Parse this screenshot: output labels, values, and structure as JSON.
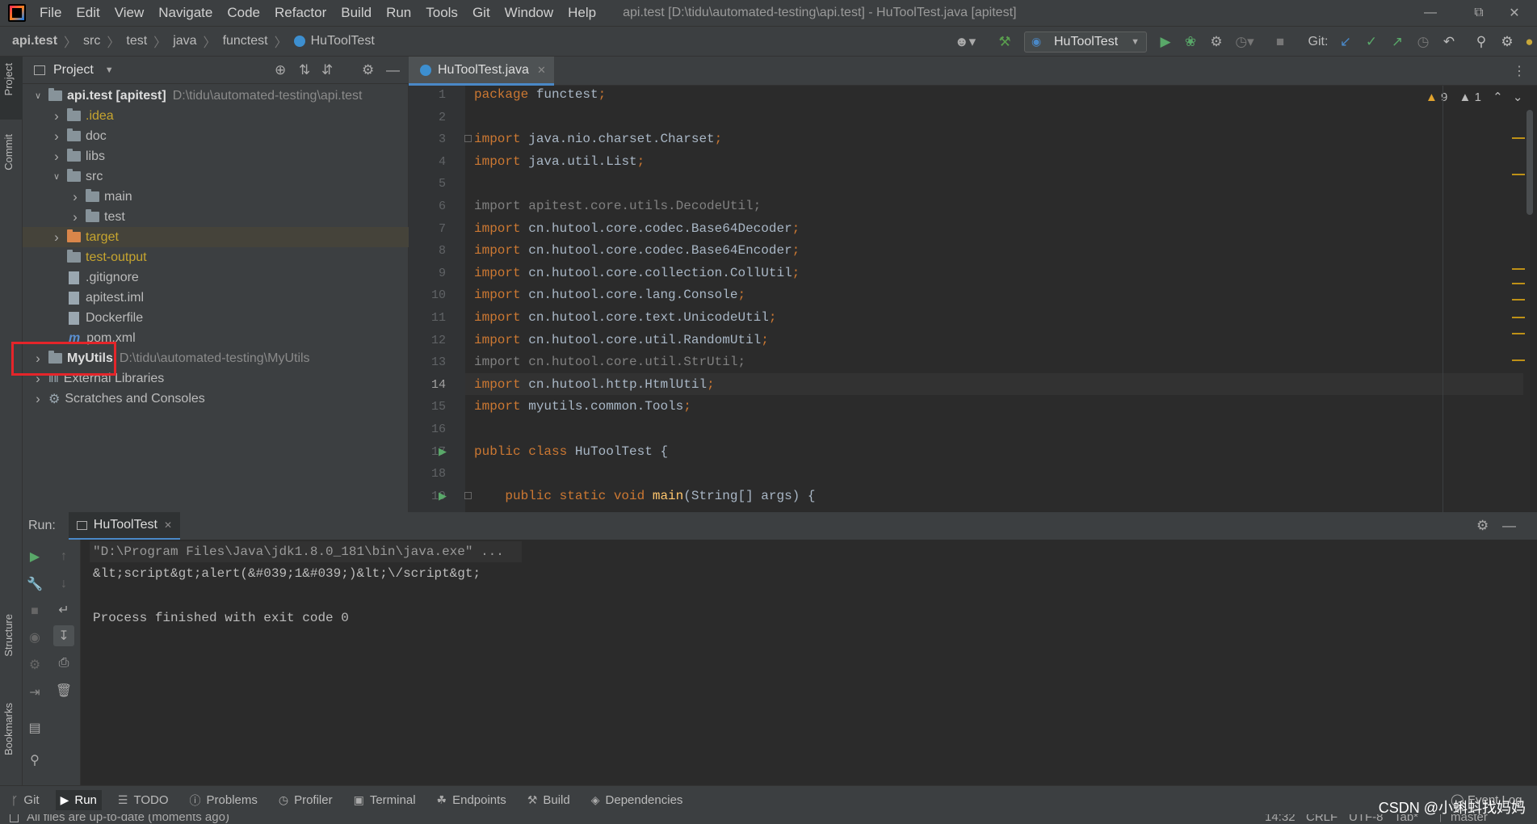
{
  "menu": [
    "File",
    "Edit",
    "View",
    "Navigate",
    "Code",
    "Refactor",
    "Build",
    "Run",
    "Tools",
    "Git",
    "Window",
    "Help"
  ],
  "window_title": "api.test [D:\\tidu\\automated-testing\\api.test] - HuToolTest.java [apitest]",
  "breadcrumb": [
    "api.test",
    "src",
    "test",
    "java",
    "functest",
    "HuToolTest"
  ],
  "run_config": "HuToolTest",
  "git_label": "Git:",
  "project": {
    "header": "Project",
    "tree": [
      {
        "label": "api.test [apitest]",
        "path": "D:\\tidu\\automated-testing\\api.test",
        "level": 0,
        "open": true,
        "icon": "module-folder",
        "bold": true
      },
      {
        "label": ".idea",
        "level": 1,
        "icon": "folder",
        "color": "yellow"
      },
      {
        "label": "doc",
        "level": 1,
        "icon": "folder"
      },
      {
        "label": "libs",
        "level": 1,
        "icon": "folder"
      },
      {
        "label": "src",
        "level": 1,
        "open": true,
        "icon": "folder"
      },
      {
        "label": "main",
        "level": 2,
        "icon": "folder"
      },
      {
        "label": "test",
        "level": 2,
        "icon": "folder"
      },
      {
        "label": "target",
        "level": 1,
        "icon": "folder-orange",
        "color": "yellow",
        "selected": true
      },
      {
        "label": "test-output",
        "level": 1,
        "icon": "folder",
        "color": "yellow",
        "noarrow": true
      },
      {
        "label": ".gitignore",
        "level": 1,
        "icon": "file",
        "noarrow": true
      },
      {
        "label": "apitest.iml",
        "level": 1,
        "icon": "file",
        "noarrow": true
      },
      {
        "label": "Dockerfile",
        "level": 1,
        "icon": "file",
        "noarrow": true
      },
      {
        "label": "pom.xml",
        "level": 1,
        "icon": "maven-file",
        "noarrow": true
      },
      {
        "label": "MyUtils",
        "path": "D:\\tidu\\automated-testing\\MyUtils",
        "level": 0,
        "icon": "module-folder",
        "bold": true
      },
      {
        "label": "External Libraries",
        "level": 0,
        "icon": "library"
      },
      {
        "label": "Scratches and Consoles",
        "level": 0,
        "icon": "scratch"
      }
    ]
  },
  "left_strip": [
    "Project",
    "Commit",
    "Structure",
    "Bookmarks"
  ],
  "editor": {
    "tab": "HuToolTest.java",
    "inspections": {
      "warnings": "9",
      "weak": "1"
    },
    "current_line": 14,
    "lines": [
      {
        "n": "1",
        "parts": [
          {
            "t": "package ",
            "c": "kw"
          },
          {
            "t": "functest",
            "c": ""
          },
          {
            "t": ";",
            "c": "kw"
          }
        ]
      },
      {
        "n": "2",
        "parts": []
      },
      {
        "n": "3",
        "parts": [
          {
            "t": "import ",
            "c": "kw"
          },
          {
            "t": "java.nio.charset.Charset",
            "c": ""
          },
          {
            "t": ";",
            "c": "kw"
          }
        ]
      },
      {
        "n": "4",
        "parts": [
          {
            "t": "import ",
            "c": "kw"
          },
          {
            "t": "java.util.List",
            "c": ""
          },
          {
            "t": ";",
            "c": "kw"
          }
        ]
      },
      {
        "n": "5",
        "parts": []
      },
      {
        "n": "6",
        "parts": [
          {
            "t": "import apitest.core.utils.DecodeUtil;",
            "c": "gr"
          }
        ]
      },
      {
        "n": "7",
        "parts": [
          {
            "t": "import ",
            "c": "kw"
          },
          {
            "t": "cn.hutool.core.codec.Base64Decoder",
            "c": ""
          },
          {
            "t": ";",
            "c": "kw"
          }
        ]
      },
      {
        "n": "8",
        "parts": [
          {
            "t": "import ",
            "c": "kw"
          },
          {
            "t": "cn.hutool.core.codec.Base64Encoder",
            "c": ""
          },
          {
            "t": ";",
            "c": "kw"
          }
        ]
      },
      {
        "n": "9",
        "parts": [
          {
            "t": "import ",
            "c": "kw"
          },
          {
            "t": "cn.hutool.core.collection.CollUtil",
            "c": ""
          },
          {
            "t": ";",
            "c": "kw"
          }
        ]
      },
      {
        "n": "10",
        "parts": [
          {
            "t": "import ",
            "c": "kw"
          },
          {
            "t": "cn.hutool.core.lang.Console",
            "c": ""
          },
          {
            "t": ";",
            "c": "kw"
          }
        ]
      },
      {
        "n": "11",
        "parts": [
          {
            "t": "import ",
            "c": "kw"
          },
          {
            "t": "cn.hutool.core.text.UnicodeUtil",
            "c": ""
          },
          {
            "t": ";",
            "c": "kw"
          }
        ]
      },
      {
        "n": "12",
        "parts": [
          {
            "t": "import ",
            "c": "kw"
          },
          {
            "t": "cn.hutool.core.util.RandomUtil",
            "c": ""
          },
          {
            "t": ";",
            "c": "kw"
          }
        ]
      },
      {
        "n": "13",
        "parts": [
          {
            "t": "import cn.hutool.core.util.StrUtil;",
            "c": "gr"
          }
        ]
      },
      {
        "n": "14",
        "parts": [
          {
            "t": "import ",
            "c": "kw"
          },
          {
            "t": "cn.hutool.http.HtmlUtil",
            "c": ""
          },
          {
            "t": ";",
            "c": "kw"
          }
        ]
      },
      {
        "n": "15",
        "parts": [
          {
            "t": "import ",
            "c": "kw"
          },
          {
            "t": "myutils.common.Tools",
            "c": ""
          },
          {
            "t": ";",
            "c": "kw"
          }
        ]
      },
      {
        "n": "16",
        "parts": []
      },
      {
        "n": "17",
        "parts": [
          {
            "t": "public class ",
            "c": "kw"
          },
          {
            "t": "HuToolTest {",
            "c": ""
          }
        ]
      },
      {
        "n": "18",
        "parts": []
      },
      {
        "n": "19",
        "parts": [
          {
            "t": "    public static void ",
            "c": "kw"
          },
          {
            "t": "main",
            "c": "fn"
          },
          {
            "t": "(String[] args) {",
            "c": ""
          }
        ]
      }
    ]
  },
  "run": {
    "label": "Run:",
    "tab": "HuToolTest",
    "output": [
      "\"D:\\Program Files\\Java\\jdk1.8.0_181\\bin\\java.exe\" ...",
      "&lt;script&gt;alert(&#039;1&#039;)&lt;\\/script&gt;",
      "",
      "Process finished with exit code 0"
    ]
  },
  "bottom_tabs": [
    {
      "label": "Git",
      "icon": "git-icon"
    },
    {
      "label": "Run",
      "icon": "run-icon",
      "active": true
    },
    {
      "label": "TODO",
      "icon": "todo-icon"
    },
    {
      "label": "Problems",
      "icon": "problems-icon"
    },
    {
      "label": "Profiler",
      "icon": "profiler-icon"
    },
    {
      "label": "Terminal",
      "icon": "terminal-icon"
    },
    {
      "label": "Endpoints",
      "icon": "endpoints-icon"
    },
    {
      "label": "Build",
      "icon": "build-icon"
    },
    {
      "label": "Dependencies",
      "icon": "dependencies-icon"
    }
  ],
  "status": {
    "message": "All files are up-to-date (moments ago)",
    "position": "14:32",
    "line_sep": "CRLF",
    "encoding": "UTF-8",
    "indent": "Tab*",
    "branch": "master",
    "event_log": "Event Log"
  },
  "watermark": "CSDN @小蝌蚪找妈妈"
}
